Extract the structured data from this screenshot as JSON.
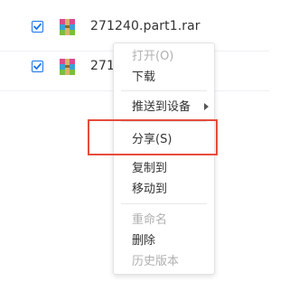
{
  "files": [
    {
      "name": "271240.part1.rar",
      "checked": true
    },
    {
      "name": "2712",
      "checked": true
    }
  ],
  "context_menu": {
    "items": [
      {
        "label": "打开(O)",
        "disabled": true
      },
      {
        "label": "下载",
        "disabled": false
      },
      {
        "label": "推送到设备",
        "disabled": false,
        "submenu": true
      },
      {
        "label": "分享(S)",
        "disabled": false,
        "highlighted": true
      },
      {
        "label": "复制到",
        "disabled": false
      },
      {
        "label": "移动到",
        "disabled": false
      },
      {
        "label": "重命名",
        "disabled": true
      },
      {
        "label": "删除",
        "disabled": false
      },
      {
        "label": "历史版本",
        "disabled": true
      }
    ]
  },
  "colors": {
    "checkbox": "#1a73e8",
    "highlight_box": "#e74c3c",
    "disabled_text": "#b0b0b0"
  },
  "icons": {
    "file": "winrar-archive-icon",
    "checkbox_check": "check-icon",
    "submenu": "chevron-right-icon"
  }
}
